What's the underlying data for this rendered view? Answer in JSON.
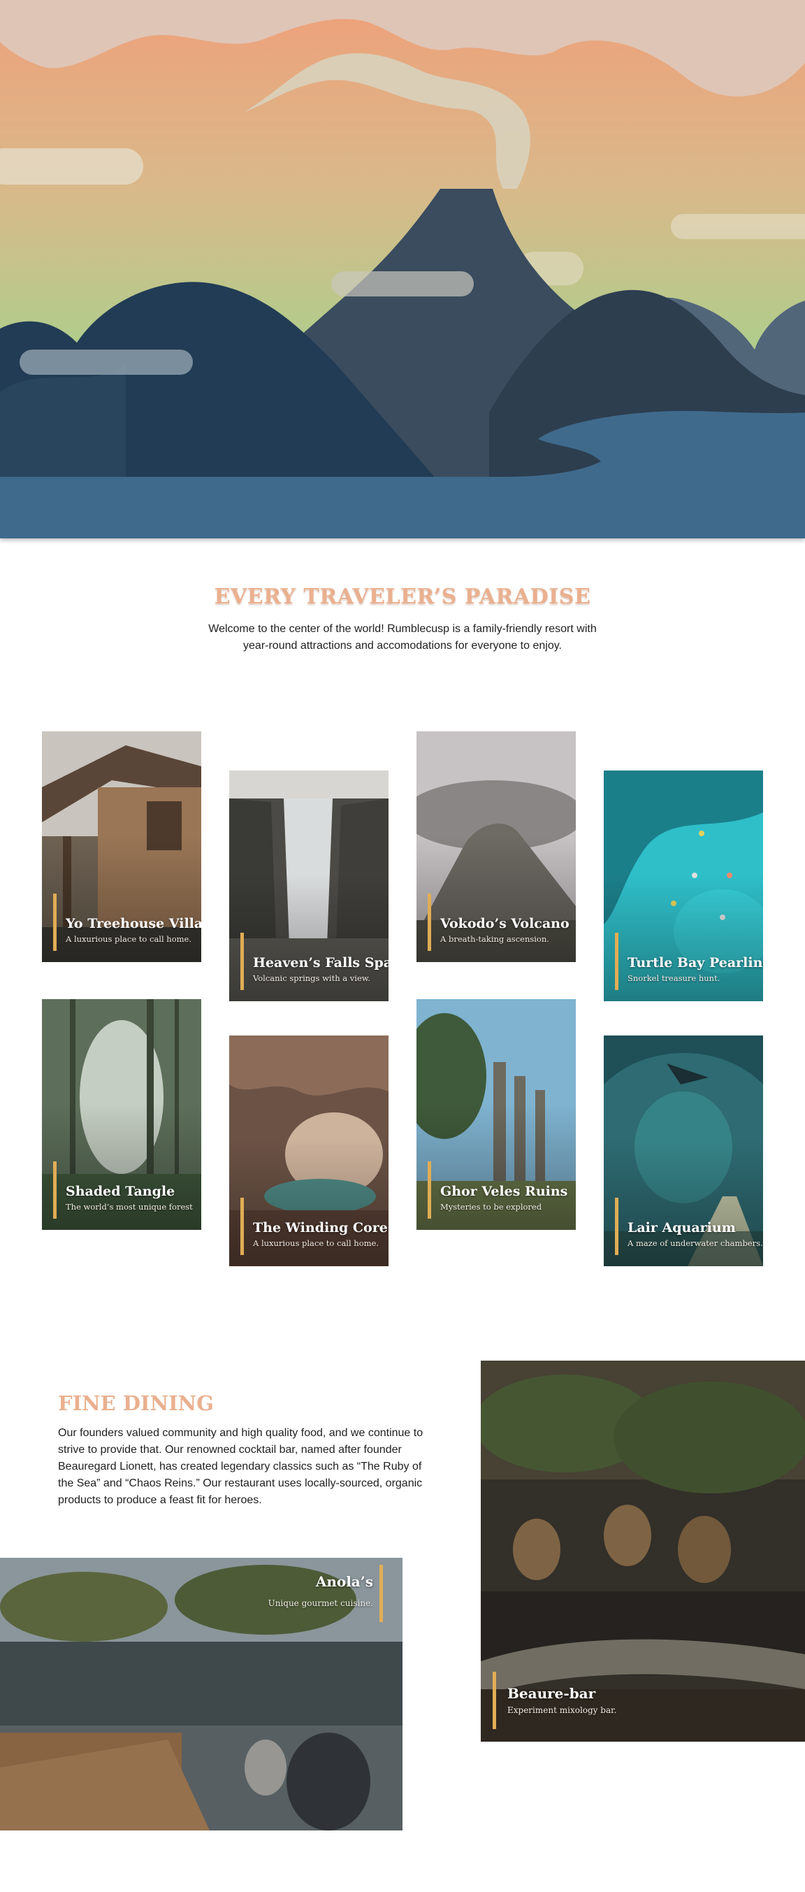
{
  "intro": {
    "title": "EVERY TRAVELER’S PARADISE",
    "text": "Welcome to the center of the world! Rumblecusp is a family-friendly resort with year-round attractions and accomodations for everyone to enjoy."
  },
  "attractions": [
    {
      "title": "Yo Treehouse Villas",
      "subtitle": "A luxurious place to call home."
    },
    {
      "title": "Heaven’s Falls Spa",
      "subtitle": "Volcanic springs with a view."
    },
    {
      "title": "Vokodo’s Volcano",
      "subtitle": "A breath-taking ascension."
    },
    {
      "title": "Turtle Bay Pearling",
      "subtitle": "Snorkel treasure hunt."
    },
    {
      "title": "Shaded Tangle",
      "subtitle": "The world’s most unique forest"
    },
    {
      "title": "The Winding Core",
      "subtitle": "A luxurious place to call home."
    },
    {
      "title": "Ghor Veles Ruins",
      "subtitle": "Mysteries to be explored"
    },
    {
      "title": "Lair Aquarium",
      "subtitle": "A maze of underwater chambers."
    }
  ],
  "dining": {
    "title": "FINE DINING",
    "text": "Our founders valued community and high quality food, and we continue to strive to provide that. Our renowned cocktail bar, named after founder Beauregard Lionett, has created legendary classics such as “The Ruby of the Sea” and “Chaos Reins.” Our restaurant uses locally-sourced, organic products to produce a feast fit for heroes.",
    "venues": [
      {
        "title": "Beaure-bar",
        "subtitle": "Experiment mixology bar."
      },
      {
        "title": "Anola’s",
        "subtitle": "Unique gourmet cuisine."
      }
    ]
  },
  "colors": {
    "accent_peach": "#eab08f",
    "caption_bar": "#e0ad55",
    "sea": "#3f6a8c",
    "mountain_dark": "#1f3b55"
  }
}
